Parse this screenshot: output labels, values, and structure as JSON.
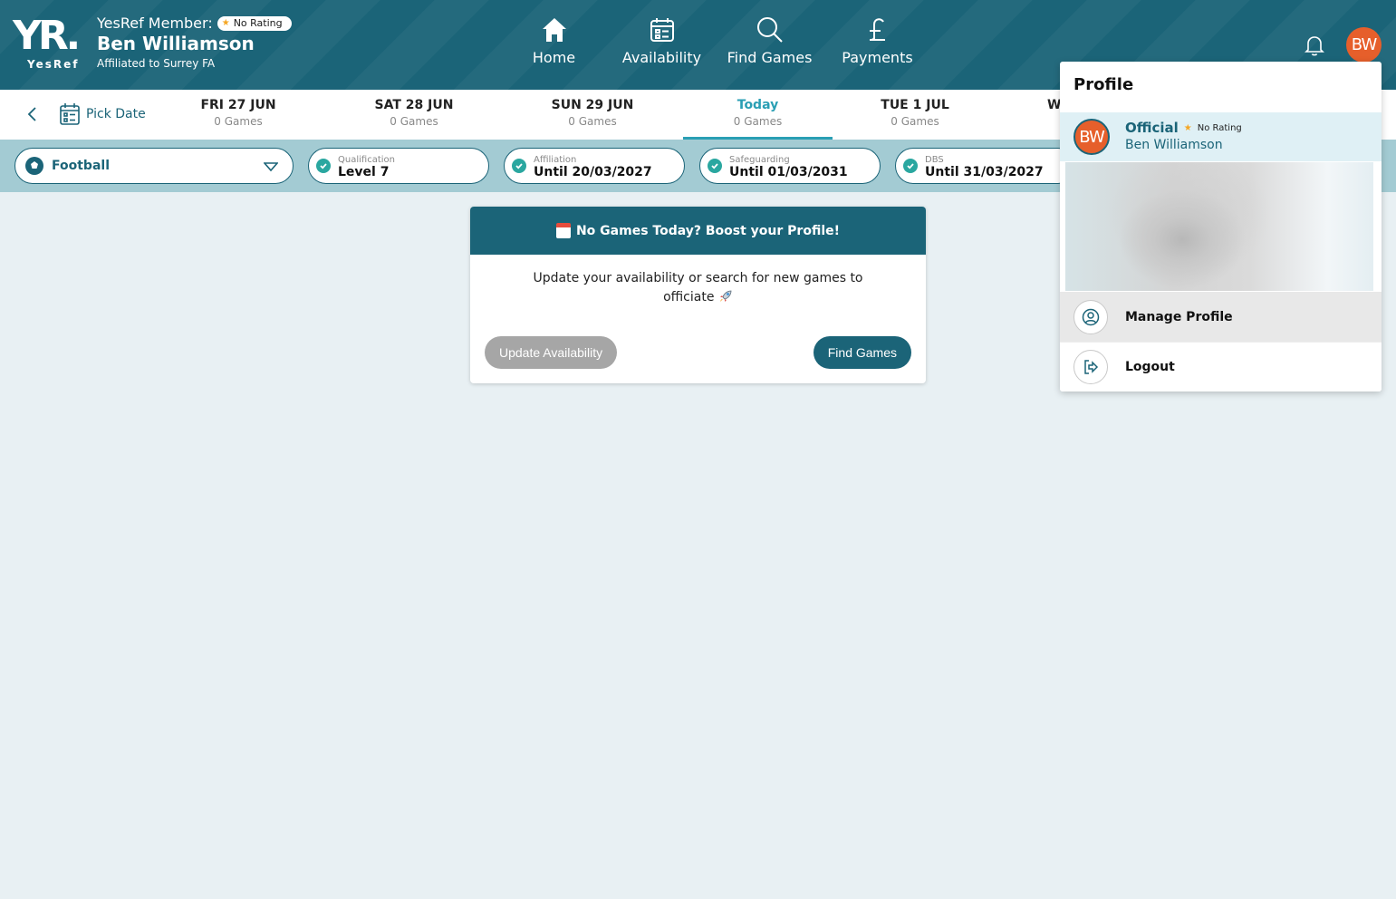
{
  "header": {
    "logo_text": "YR.",
    "logo_brand": "YesRef",
    "member_label": "YesRef Member:",
    "rating_badge": "No Rating",
    "member_name": "Ben Williamson",
    "affiliation": "Affiliated to Surrey FA",
    "avatar_initials": "BW"
  },
  "nav": {
    "items": [
      {
        "label": "Home",
        "icon": "home-icon"
      },
      {
        "label": "Availability",
        "icon": "calendar-icon"
      },
      {
        "label": "Find Games",
        "icon": "search-icon"
      },
      {
        "label": "Payments",
        "icon": "pound-icon"
      }
    ]
  },
  "datebar": {
    "pick_date": "Pick Date",
    "days": [
      {
        "day": "FRI 27 JUN",
        "games": "0 Games"
      },
      {
        "day": "SAT 28 JUN",
        "games": "0 Games"
      },
      {
        "day": "SUN 29 JUN",
        "games": "0 Games"
      },
      {
        "day": "Today",
        "games": "0 Games"
      },
      {
        "day": "TUE 1 JUL",
        "games": "0 Games"
      },
      {
        "day": "W",
        "games": ""
      }
    ]
  },
  "filters": {
    "sport": "Football",
    "pills": [
      {
        "label": "Qualification",
        "value": "Level 7"
      },
      {
        "label": "Affiliation",
        "value": "Until 20/03/2027"
      },
      {
        "label": "Safeguarding",
        "value": "Until 01/03/2031"
      },
      {
        "label": "DBS",
        "value": "Until 31/03/2027"
      }
    ]
  },
  "card": {
    "title": "No Games Today? Boost your Profile!",
    "body": "Update your availability or search for new games to officiate",
    "btn_availability": "Update Availability",
    "btn_find": "Find Games"
  },
  "profile_menu": {
    "title": "Profile",
    "avatar_initials": "BW",
    "role": "Official",
    "rating": "No Rating",
    "name": "Ben Williamson",
    "manage": "Manage Profile",
    "logout": "Logout"
  },
  "colors": {
    "primary": "#1b6478",
    "accent": "#2a9fb4",
    "avatar": "#e65f2b",
    "filterbar": "#a3cbd3"
  }
}
